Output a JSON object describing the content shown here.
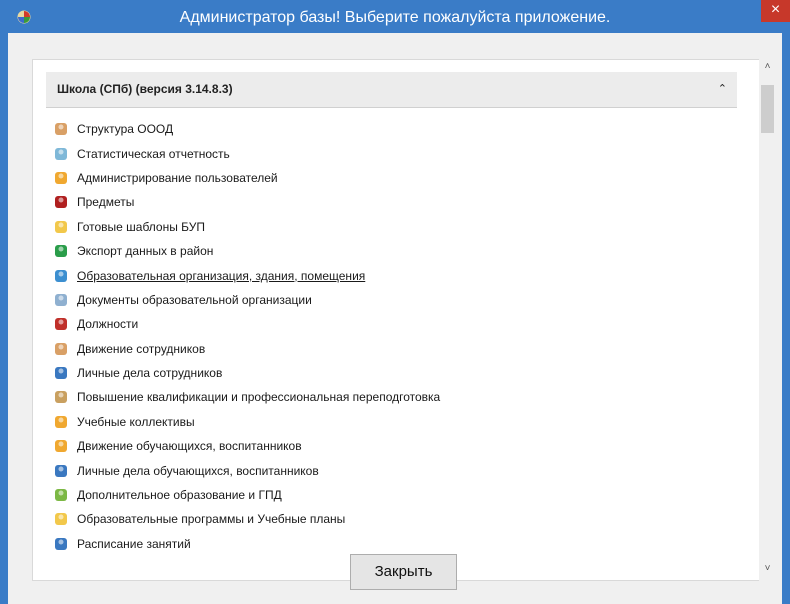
{
  "window": {
    "title": "Администратор базы! Выберите пожалуйста приложение.",
    "close_glyph": "×"
  },
  "group": {
    "title": "Школа (СПб) (версия 3.14.8.3)",
    "collapse_glyph": "⌃"
  },
  "items": [
    {
      "label": "Структура ОООД",
      "icon": "person-icon",
      "color": "#d9a066"
    },
    {
      "label": "Статистическая отчетность",
      "icon": "report-icon",
      "color": "#7fb8d8"
    },
    {
      "label": "Администрирование пользователей",
      "icon": "user-icon",
      "color": "#f0a830"
    },
    {
      "label": "Предметы",
      "icon": "board-icon",
      "color": "#b02020"
    },
    {
      "label": "Готовые шаблоны БУП",
      "icon": "folder-icon",
      "color": "#f2c84b"
    },
    {
      "label": "Экспорт данных в район",
      "icon": "export-icon",
      "color": "#2a9d4a"
    },
    {
      "label": "Образовательная организация, здания, помещения",
      "icon": "building-icon",
      "color": "#3c8fd0"
    },
    {
      "label": "Документы образовательной организации",
      "icon": "document-icon",
      "color": "#8fb0d0"
    },
    {
      "label": "Должности",
      "icon": "briefcase-icon",
      "color": "#c0302a"
    },
    {
      "label": "Движение сотрудников",
      "icon": "person-icon",
      "color": "#d9a066"
    },
    {
      "label": "Личные дела сотрудников",
      "icon": "card-icon",
      "color": "#3a78c0"
    },
    {
      "label": "Повышение квалификации и профессиональная переподготовка",
      "icon": "graduate-icon",
      "color": "#c9a060"
    },
    {
      "label": "Учебные коллективы",
      "icon": "group-icon",
      "color": "#f0a830"
    },
    {
      "label": "Движение обучающихся, воспитанников",
      "icon": "user-icon",
      "color": "#f0a830"
    },
    {
      "label": "Личные дела обучающихся, воспитанников",
      "icon": "card-icon",
      "color": "#3a78c0"
    },
    {
      "label": "Дополнительное образование и ГПД",
      "icon": "group-icon",
      "color": "#7cb845"
    },
    {
      "label": "Образовательные программы и Учебные планы",
      "icon": "folder-icon",
      "color": "#f2c84b"
    },
    {
      "label": "Расписание занятий",
      "icon": "calendar-icon",
      "color": "#3a78c0"
    }
  ],
  "active_item": 6,
  "scrollbar": {
    "up_glyph": "˄",
    "down_glyph": "˅"
  },
  "footer": {
    "close_label": "Закрыть"
  }
}
